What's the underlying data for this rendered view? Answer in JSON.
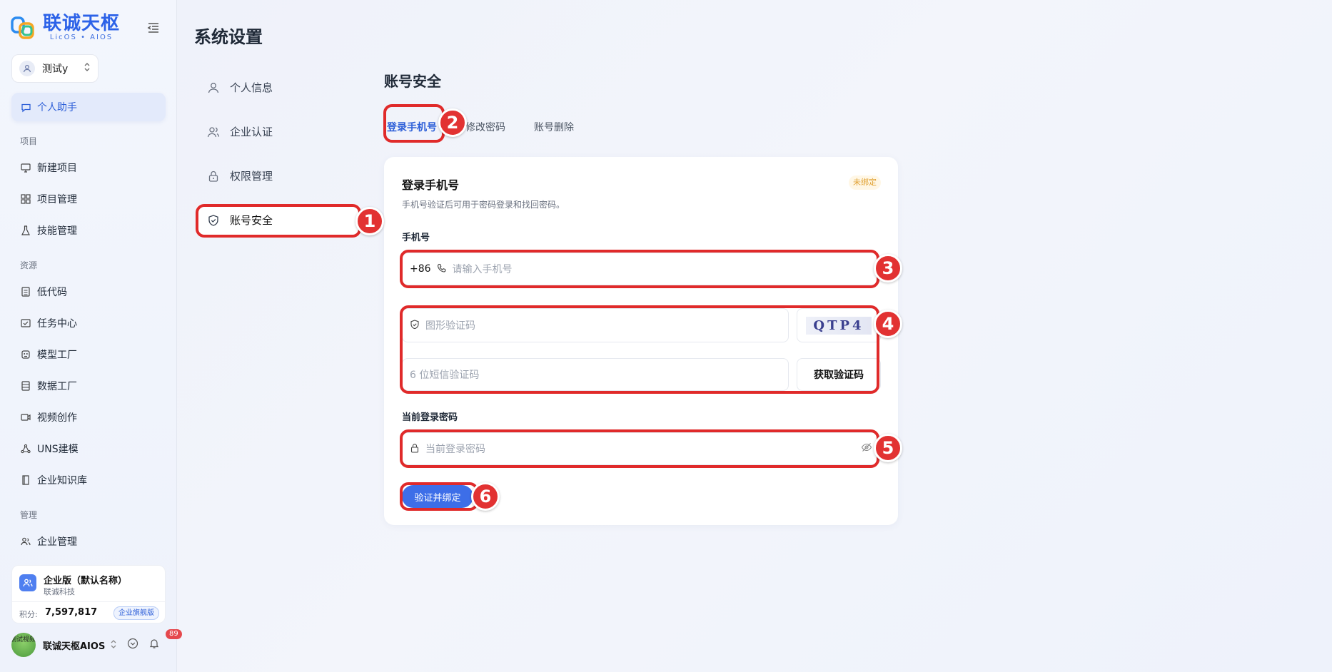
{
  "app": {
    "logo_title": "联诚天枢",
    "logo_subtitle": "LicOS • AIOS"
  },
  "team": {
    "name": "测试y"
  },
  "sidebar": {
    "active_item": "个人助手",
    "sections": [
      {
        "title": "项目",
        "items": [
          "新建项目",
          "项目管理",
          "技能管理"
        ]
      },
      {
        "title": "资源",
        "items": [
          "低代码",
          "任务中心",
          "模型工厂",
          "数据工厂",
          "视频创作",
          "UNS建模",
          "企业知识库"
        ]
      },
      {
        "title": "管理",
        "items": [
          "企业管理"
        ]
      }
    ]
  },
  "enterprise": {
    "name": "企业版（默认名称）",
    "company": "联诚科技",
    "points_label": "积分:",
    "points": "7,597,817",
    "edition": "企业旗舰版"
  },
  "user": {
    "name": "联诚天枢AIOS",
    "avatar_text": "测试视频",
    "notifications": "89"
  },
  "page": {
    "title": "系统设置",
    "menu": [
      "个人信息",
      "企业认证",
      "权限管理",
      "账号安全"
    ],
    "section_title": "账号安全",
    "tabs": [
      "登录手机号",
      "修改密码",
      "账号删除"
    ]
  },
  "card": {
    "title": "登录手机号",
    "status": "未绑定",
    "description": "手机号验证后可用于密码登录和找回密码。",
    "phone_label": "手机号",
    "country_code": "+86",
    "phone_placeholder": "请输入手机号",
    "captcha_placeholder": "图形验证码",
    "captcha_text": "QTP4",
    "sms_placeholder": "6 位短信验证码",
    "sms_button": "获取验证码",
    "password_label": "当前登录密码",
    "password_placeholder": "当前登录密码",
    "submit": "验证并绑定"
  },
  "annotations": [
    "1",
    "2",
    "3",
    "4",
    "5",
    "6"
  ],
  "colors": {
    "accent": "#2d5fd8",
    "annotation": "#e02a2a",
    "button": "#3d6ee8",
    "status_badge": "#e0a030"
  }
}
